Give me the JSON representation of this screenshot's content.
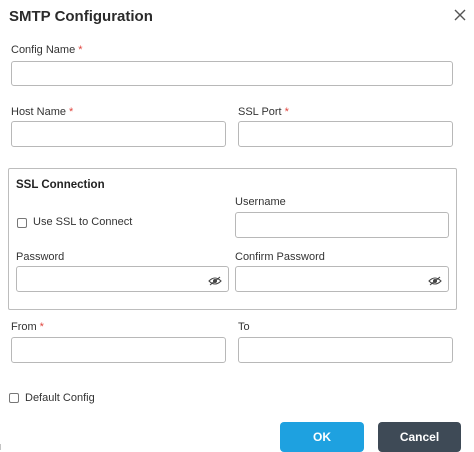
{
  "dialog": {
    "title": "SMTP Configuration",
    "close_icon": "close-icon"
  },
  "fields": {
    "config_name": {
      "label": "Config Name",
      "required": "*",
      "value": ""
    },
    "host_name": {
      "label": "Host Name",
      "required": "*",
      "value": ""
    },
    "ssl_port": {
      "label": "SSL Port",
      "required": "*",
      "value": ""
    },
    "from": {
      "label": "From",
      "required": "*",
      "value": ""
    },
    "to": {
      "label": "To",
      "value": ""
    }
  },
  "ssl_connection": {
    "title": "SSL Connection",
    "use_ssl_label": "Use SSL to Connect",
    "use_ssl_checked": false,
    "username": {
      "label": "Username",
      "value": ""
    },
    "password": {
      "label": "Password",
      "value": "",
      "toggle_icon": "eye-icon"
    },
    "confirm_password": {
      "label": "Confirm Password",
      "value": "",
      "toggle_icon": "eye-icon"
    }
  },
  "default_config": {
    "label": "Default Config",
    "checked": false
  },
  "buttons": {
    "ok": "OK",
    "cancel": "Cancel"
  },
  "colors": {
    "accent": "#1ea1e0",
    "cancel": "#3e4a56",
    "required": "#e0463f"
  }
}
